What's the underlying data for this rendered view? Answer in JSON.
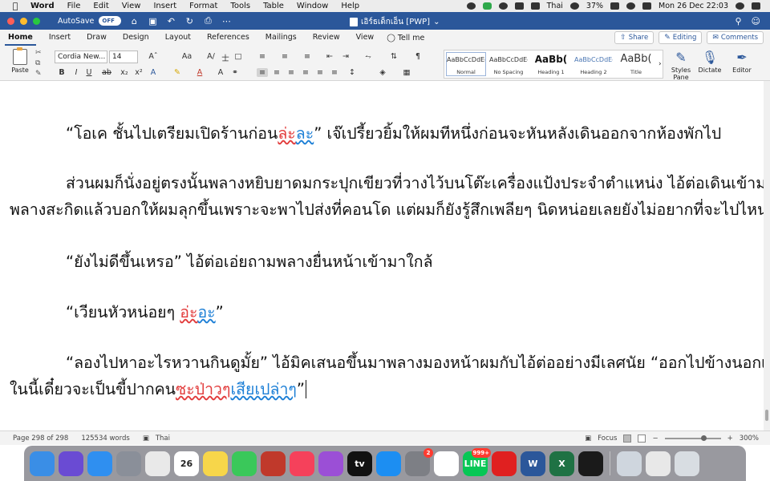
{
  "menubar": {
    "app_name": "Word",
    "items": [
      "File",
      "Edit",
      "View",
      "Insert",
      "Format",
      "Tools",
      "Table",
      "Window",
      "Help"
    ],
    "input_language": "Thai",
    "battery": "37%",
    "datetime": "Mon 26 Dec  22:03"
  },
  "titlebar": {
    "autosave_label": "AutoSave",
    "autosave_state": "OFF",
    "document_title": "เอิร์ธเด็กเอ็น [PWP]"
  },
  "tabs": {
    "items": [
      "Home",
      "Insert",
      "Draw",
      "Design",
      "Layout",
      "References",
      "Mailings",
      "Review",
      "View"
    ],
    "tell_me": "Tell me",
    "share": "Share",
    "editing": "Editing",
    "comments": "Comments"
  },
  "ribbon": {
    "paste_label": "Paste",
    "font_name": "Cordia New...",
    "font_size": "14",
    "styles": [
      {
        "sample": "AaBbCcDdEe",
        "name": "Normal"
      },
      {
        "sample": "AaBbCcDdEe",
        "name": "No Spacing"
      },
      {
        "sample": "AaBb(",
        "name": "Heading 1"
      },
      {
        "sample": "AaBbCcDdEe",
        "name": "Heading 2"
      },
      {
        "sample": "AaBb(",
        "name": "Title"
      }
    ],
    "styles_pane": "Styles\nPane",
    "dictate": "Dictate",
    "editor": "Editor"
  },
  "document": {
    "p1_pre": "“โอเค ชั้นไปเตรียมเปิดร้านก่อน",
    "p1_mark": "ล่ะ",
    "p1_mark2": "ละ",
    "p1_post": "” เจ๊เปรี้ยวยิ้มให้ผมทีหนึ่งก่อนจะหันหลังเดินออกจากห้องพักไป",
    "p2_line1": "ส่วนผมก็นั่งอยู่ตรงนั้นพลางหยิบยาดมกระปุกเขียวที่วางไว้บนโต๊ะเครื่องแป้งประจำตำแหน่ง ไอ้ต่อเดินเข้ามาใกล้",
    "p2_line2": "พลางสะกิดแล้วบอกให้ผมลุกขึ้นเพราะจะพาไปส่งที่คอนโด แต่ผมก็ยังรู้สึกเพลียๆ นิดหน่อยเลยยังไม่อยากที่จะไปไหน",
    "p3": "“ยังไม่ดีขึ้นเหรอ” ไอ้ต่อเอ่ยถามพลางยื่นหน้าเข้ามาใกล้",
    "p4_pre": "“เวียนหัวหน่อยๆ ",
    "p4_mark1": "อ่ะ",
    "p4_mark2": "อะ",
    "p4_post": "”",
    "p5_line1": "“ลองไปหาอะไรหวานกินดูมั้ย” ไอ้มิคเสนอขึ้นมาพลางมองหน้าผมกับไอ้ต่ออย่างมีเลศนัย “ออกไปข้างนอกเถอะ อยู่",
    "p5_line2_pre": "ในนี้เดี๋ยวจะเป็นขี้ปากคน",
    "p5_mark1": "ซะป่าวๆ",
    "p5_mark2": "เสียเปล่าๆ",
    "p5_post": "”"
  },
  "statusbar": {
    "page": "Page 298 of 298",
    "words": "125534 words",
    "language": "Thai",
    "focus": "Focus",
    "zoom": "300%",
    "zoom_level": 0.7
  },
  "dock": {
    "apps": [
      {
        "name": "Finder",
        "color": "#3a8ee6"
      },
      {
        "name": "Siri",
        "color": "#6a4bd3"
      },
      {
        "name": "Safari",
        "color": "#2f8ff0"
      },
      {
        "name": "Launchpad",
        "color": "#8a8f99"
      },
      {
        "name": "Chrome",
        "color": "#e9e9e9"
      },
      {
        "name": "Calendar",
        "color": "#ffffff",
        "label": "26"
      },
      {
        "name": "Notes",
        "color": "#f7d64a"
      },
      {
        "name": "FaceTime",
        "color": "#3ac85a"
      },
      {
        "name": "Photo Booth",
        "color": "#c0392b"
      },
      {
        "name": "Music",
        "color": "#f5415b"
      },
      {
        "name": "Podcasts",
        "color": "#9b4fd6"
      },
      {
        "name": "TV",
        "color": "#111111",
        "label": "tv"
      },
      {
        "name": "App Store",
        "color": "#1c8ef2"
      },
      {
        "name": "System Preferences",
        "color": "#7d7f85",
        "badge": "2"
      },
      {
        "name": "Reminders",
        "color": "#ffffff"
      },
      {
        "name": "LINE",
        "color": "#06c755",
        "label": "LINE",
        "badge": "999+"
      },
      {
        "name": "Acrobat",
        "color": "#e02020"
      },
      {
        "name": "Word",
        "color": "#2b579a",
        "label": "W"
      },
      {
        "name": "Excel",
        "color": "#1f7244",
        "label": "X"
      },
      {
        "name": "Kindle",
        "color": "#1a1a1a"
      }
    ],
    "recent": [
      {
        "name": "Preview",
        "color": "#cfd6de"
      },
      {
        "name": "Downloads",
        "color": "#e8e8e8"
      },
      {
        "name": "Trash",
        "color": "#d8dde2"
      }
    ]
  }
}
